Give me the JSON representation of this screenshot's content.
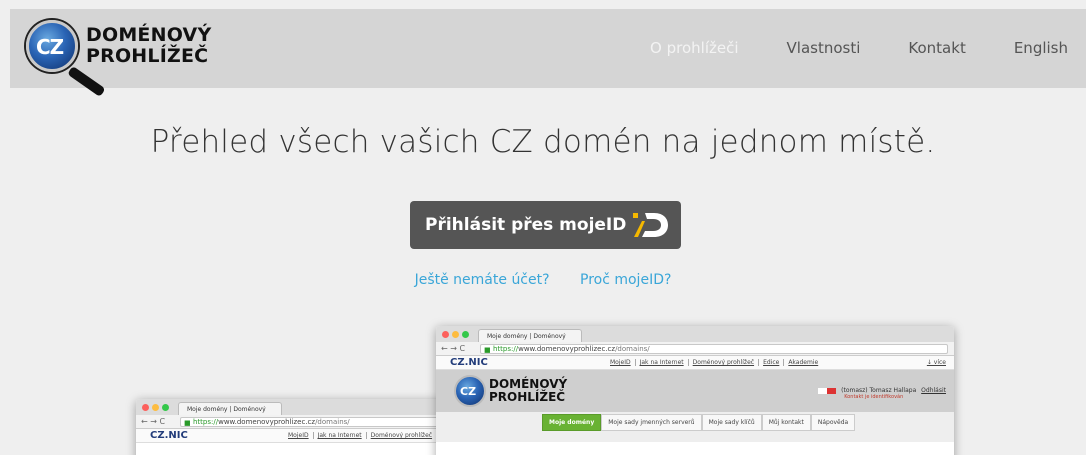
{
  "header": {
    "logo": {
      "badge": "CZ",
      "line1": "DOMÉNOVÝ",
      "line2": "PROHLÍŽEČ"
    },
    "nav": [
      {
        "label": "O prohlížeči",
        "active": true
      },
      {
        "label": "Vlastnosti",
        "active": false
      },
      {
        "label": "Kontakt",
        "active": false
      },
      {
        "label": "English",
        "active": false
      }
    ]
  },
  "hero": {
    "title": "Přehled všech vašich CZ domén na jednom místě.",
    "login_button": "Přihlásit přes mojeID",
    "links": [
      "Ještě nemáte účet?",
      "Proč mojeID?"
    ]
  },
  "mockup": {
    "tab_title": "Moje domény | Doménový",
    "url_scheme": "https://",
    "url_host": "www.domenovyprohlizec.cz",
    "url_path": "/domains/",
    "site_logo": "CZ.NIC",
    "site_links": [
      "MojeID",
      "Jak na Internet",
      "Doménový prohlížeč",
      "Edice",
      "Akademie"
    ],
    "more": "↓ více",
    "user": "(tomasz) Tomasz Hallapa",
    "logout": "Odhlásit",
    "user_sub": "Kontakt je identifikován",
    "subtabs": [
      "Moje domény",
      "Moje sady jmenných serverů",
      "Moje sady klíčů",
      "Můj kontakt",
      "Nápověda"
    ]
  },
  "colors": {
    "header_bg": "#d5d5d5",
    "page_bg": "#efefef",
    "button_bg": "#555555",
    "link": "#3aa6d8",
    "mojeid_yellow": "#f5b800",
    "active_tab": "#69b233"
  }
}
